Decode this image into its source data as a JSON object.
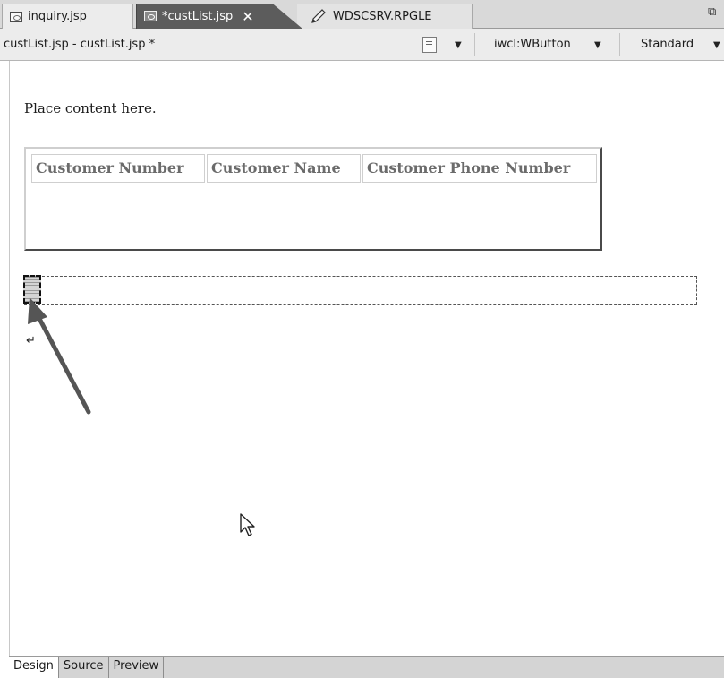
{
  "editor_tabs": [
    {
      "label": "inquiry.jsp",
      "icon": "jsp-file-icon",
      "active": false
    },
    {
      "label": "*custList.jsp",
      "icon": "jsp-file-icon",
      "active": true,
      "close": "✕"
    },
    {
      "label": "WDSCSRV.RPGLE",
      "icon": "pencil-icon",
      "active": false
    }
  ],
  "toolbar": {
    "editor_title": "custList.jsp - custList.jsp *",
    "component_select": "iwcl:WButton",
    "style_select": "Standard"
  },
  "canvas": {
    "placeholder_text": "Place content here.",
    "table_headers": [
      "Customer Number",
      "Customer Name",
      "Customer Phone Number"
    ],
    "return_mark": "↵"
  },
  "bottom_tabs": [
    {
      "label": "Design",
      "active": true
    },
    {
      "label": "Source",
      "active": false
    },
    {
      "label": "Preview",
      "active": false
    }
  ],
  "colors": {
    "active_tab": "#5c5c5c",
    "tab_strip": "#d9d9d9",
    "annotation_arrow": "#555555"
  }
}
